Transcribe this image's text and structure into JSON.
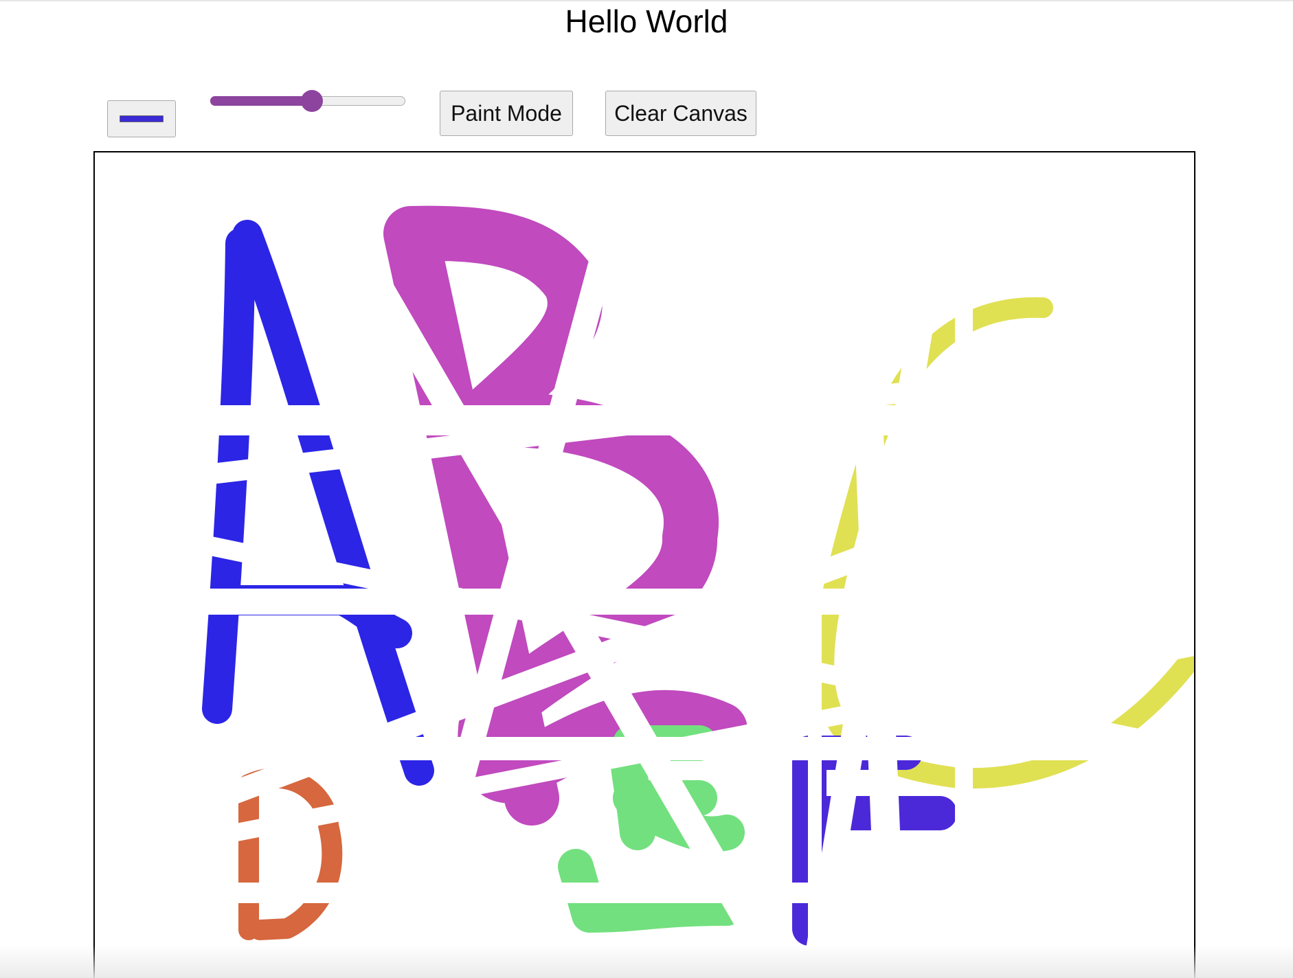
{
  "page": {
    "title": "Hello World"
  },
  "toolbar": {
    "color_picker": {
      "selected_color": "#3b2ad6"
    },
    "brush_size_slider": {
      "value_fraction": 0.52
    },
    "paint_mode_label": "Paint Mode",
    "clear_canvas_label": "Clear Canvas"
  },
  "canvas": {
    "background": "#ffffff",
    "stroke_colors": {
      "letter_a": "#2c25e6",
      "letter_b": "#c04abe",
      "letter_c": "#e0e053",
      "letter_d": "#d6673e",
      "letter_e": "#72e07e",
      "letter_f": "#4b29d9"
    }
  }
}
